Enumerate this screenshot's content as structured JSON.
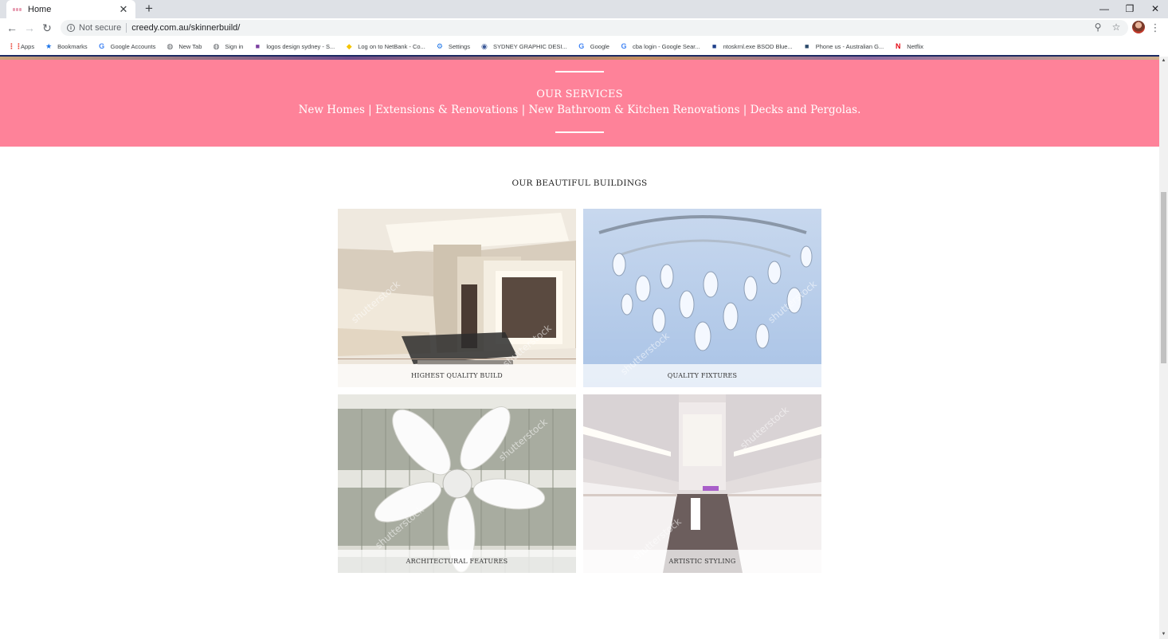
{
  "browser": {
    "tab_title": "Home",
    "not_secure": "Not secure",
    "url": "creedy.com.au/skinnerbuild/",
    "bookmarks": [
      {
        "label": "Apps",
        "icon": "apps-grid-icon",
        "color": "#ea4335"
      },
      {
        "label": "Bookmarks",
        "icon": "star-icon",
        "color": "#1a73e8"
      },
      {
        "label": "Google Accounts",
        "icon": "google-icon",
        "color": "#4285f4"
      },
      {
        "label": "New Tab",
        "icon": "globe-icon",
        "color": "#5f6368"
      },
      {
        "label": "Sign in",
        "icon": "globe-icon",
        "color": "#5f6368"
      },
      {
        "label": "logos design sydney - S...",
        "icon": "site-icon",
        "color": "#7b3fa0"
      },
      {
        "label": "Log on to NetBank - Co...",
        "icon": "commbank-icon",
        "color": "#f5c400"
      },
      {
        "label": "Settings",
        "icon": "gear-icon",
        "color": "#1a73e8"
      },
      {
        "label": "SYDNEY GRAPHIC DESI...",
        "icon": "eye-icon",
        "color": "#3b5998"
      },
      {
        "label": "Google",
        "icon": "google-icon",
        "color": "#4285f4"
      },
      {
        "label": "cba login - Google Sear...",
        "icon": "google-icon",
        "color": "#4285f4"
      },
      {
        "label": "ntoskrnl.exe BSOD Blue...",
        "icon": "site-icon",
        "color": "#1e3f8a"
      },
      {
        "label": "Phone us - Australian G...",
        "icon": "site-icon",
        "color": "#2c4a6b"
      },
      {
        "label": "Netflix",
        "icon": "netflix-icon",
        "color": "#e50914"
      }
    ]
  },
  "services": {
    "title": "OUR SERVICES",
    "list": "New Homes | Extensions & Renovations | New Bathroom & Kitchen Renovations | Decks and Pergolas."
  },
  "buildings": {
    "title": "OUR BEAUTIFUL BUILDINGS",
    "cards": [
      {
        "caption": "HIGHEST QUALITY BUILD"
      },
      {
        "caption": "QUALITY FIXTURES"
      },
      {
        "caption": "ARCHITECTURAL FEATURES"
      },
      {
        "caption": "ARTISTIC STYLING"
      }
    ]
  },
  "colors": {
    "services_band": "#fe8299",
    "nav_border": "#1c2a63"
  }
}
